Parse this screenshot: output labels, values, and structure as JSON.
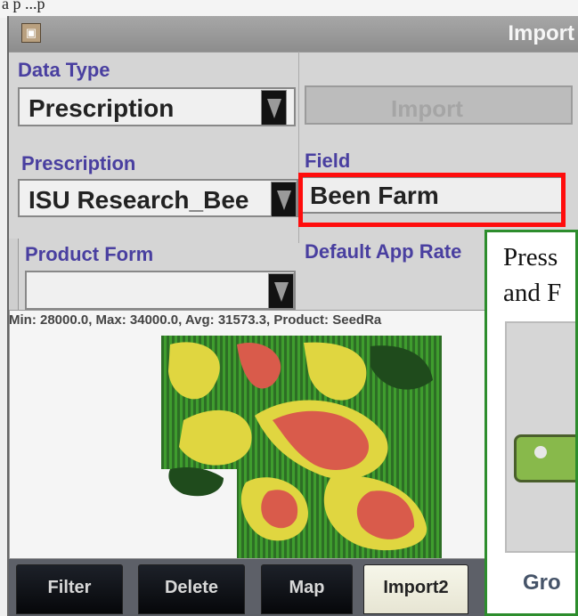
{
  "overlay_text": "a p ...p",
  "window": {
    "title": "Import"
  },
  "labels": {
    "data_type": "Data Type",
    "prescription": "Prescription",
    "field": "Field",
    "product_form": "Product Form",
    "default_app_rate": "Default App Rate"
  },
  "values": {
    "data_type": "Prescription",
    "prescription": "ISU Research_Bee",
    "field": "Been Farm",
    "product_form": ""
  },
  "buttons": {
    "import": "Import"
  },
  "info": {
    "summary": "Min: 28000.0, Max: 34000.0, Avg: 31573.3, Product: SeedRa"
  },
  "tabs": [
    {
      "label": "Filter"
    },
    {
      "label": "Delete"
    },
    {
      "label": "Map"
    },
    {
      "label": "Import2"
    }
  ],
  "callout": {
    "line1": "Press",
    "line2": "and F",
    "bottom_text": "Gro"
  },
  "colors": {
    "accent_label": "#493fa0",
    "highlight": "#ff0d0d",
    "callout_border": "#2d8d2d"
  }
}
